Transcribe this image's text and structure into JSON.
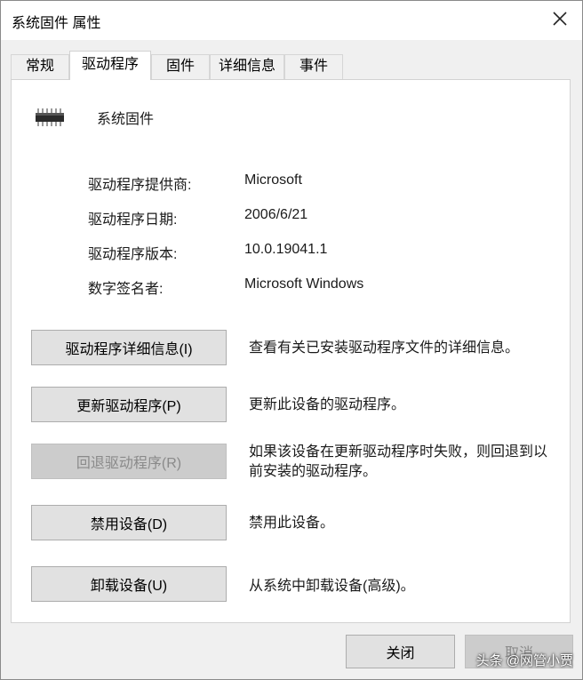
{
  "window": {
    "title": "系统固件 属性",
    "close_icon": "close-icon"
  },
  "tabs": [
    {
      "label": "常规",
      "active": false
    },
    {
      "label": "驱动程序",
      "active": true
    },
    {
      "label": "固件",
      "active": false
    },
    {
      "label": "详细信息",
      "active": false
    },
    {
      "label": "事件",
      "active": false
    }
  ],
  "device": {
    "name": "系统固件",
    "icon": "chip-icon"
  },
  "info": [
    {
      "label": "驱动程序提供商:",
      "value": "Microsoft"
    },
    {
      "label": "驱动程序日期:",
      "value": "2006/6/21"
    },
    {
      "label": "驱动程序版本:",
      "value": "10.0.19041.1"
    },
    {
      "label": "数字签名者:",
      "value": "Microsoft Windows"
    }
  ],
  "actions": [
    {
      "button": "驱动程序详细信息(I)",
      "description": "查看有关已安装驱动程序文件的详细信息。",
      "enabled": true
    },
    {
      "button": "更新驱动程序(P)",
      "description": "更新此设备的驱动程序。",
      "enabled": true
    },
    {
      "button": "回退驱动程序(R)",
      "description": "如果该设备在更新驱动程序时失败，则回退到以前安装的驱动程序。",
      "enabled": false
    },
    {
      "button": "禁用设备(D)",
      "description": "禁用此设备。",
      "enabled": true
    },
    {
      "button": "卸载设备(U)",
      "description": "从系统中卸载设备(高级)。",
      "enabled": true
    }
  ],
  "footer": {
    "close_label": "关闭",
    "cancel_label": "取消"
  },
  "watermark": "头条 @网管小贾",
  "colors": {
    "panel": "#ffffff",
    "dialog": "#f0f0f0",
    "button": "#e1e1e1",
    "button_disabled": "#cccccc"
  }
}
